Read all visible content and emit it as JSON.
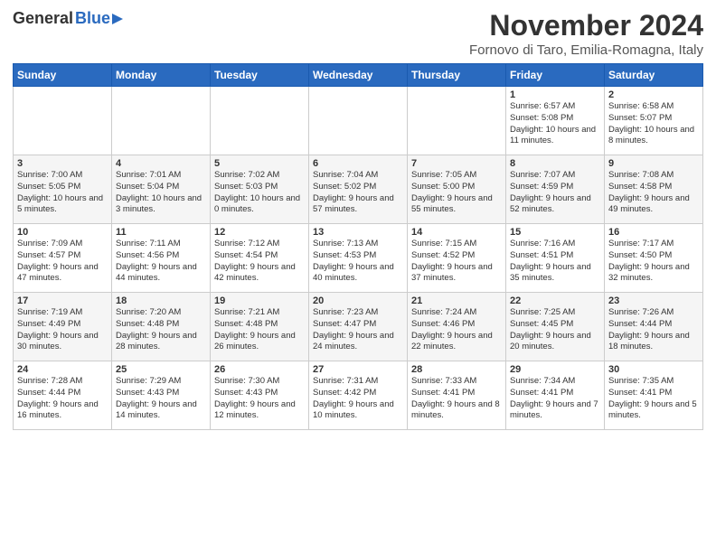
{
  "header": {
    "logo_general": "General",
    "logo_blue": "Blue",
    "title": "November 2024",
    "location": "Fornovo di Taro, Emilia-Romagna, Italy"
  },
  "days_of_week": [
    "Sunday",
    "Monday",
    "Tuesday",
    "Wednesday",
    "Thursday",
    "Friday",
    "Saturday"
  ],
  "weeks": [
    [
      {
        "day": "",
        "info": ""
      },
      {
        "day": "",
        "info": ""
      },
      {
        "day": "",
        "info": ""
      },
      {
        "day": "",
        "info": ""
      },
      {
        "day": "",
        "info": ""
      },
      {
        "day": "1",
        "info": "Sunrise: 6:57 AM\nSunset: 5:08 PM\nDaylight: 10 hours and 11 minutes."
      },
      {
        "day": "2",
        "info": "Sunrise: 6:58 AM\nSunset: 5:07 PM\nDaylight: 10 hours and 8 minutes."
      }
    ],
    [
      {
        "day": "3",
        "info": "Sunrise: 7:00 AM\nSunset: 5:05 PM\nDaylight: 10 hours and 5 minutes."
      },
      {
        "day": "4",
        "info": "Sunrise: 7:01 AM\nSunset: 5:04 PM\nDaylight: 10 hours and 3 minutes."
      },
      {
        "day": "5",
        "info": "Sunrise: 7:02 AM\nSunset: 5:03 PM\nDaylight: 10 hours and 0 minutes."
      },
      {
        "day": "6",
        "info": "Sunrise: 7:04 AM\nSunset: 5:02 PM\nDaylight: 9 hours and 57 minutes."
      },
      {
        "day": "7",
        "info": "Sunrise: 7:05 AM\nSunset: 5:00 PM\nDaylight: 9 hours and 55 minutes."
      },
      {
        "day": "8",
        "info": "Sunrise: 7:07 AM\nSunset: 4:59 PM\nDaylight: 9 hours and 52 minutes."
      },
      {
        "day": "9",
        "info": "Sunrise: 7:08 AM\nSunset: 4:58 PM\nDaylight: 9 hours and 49 minutes."
      }
    ],
    [
      {
        "day": "10",
        "info": "Sunrise: 7:09 AM\nSunset: 4:57 PM\nDaylight: 9 hours and 47 minutes."
      },
      {
        "day": "11",
        "info": "Sunrise: 7:11 AM\nSunset: 4:56 PM\nDaylight: 9 hours and 44 minutes."
      },
      {
        "day": "12",
        "info": "Sunrise: 7:12 AM\nSunset: 4:54 PM\nDaylight: 9 hours and 42 minutes."
      },
      {
        "day": "13",
        "info": "Sunrise: 7:13 AM\nSunset: 4:53 PM\nDaylight: 9 hours and 40 minutes."
      },
      {
        "day": "14",
        "info": "Sunrise: 7:15 AM\nSunset: 4:52 PM\nDaylight: 9 hours and 37 minutes."
      },
      {
        "day": "15",
        "info": "Sunrise: 7:16 AM\nSunset: 4:51 PM\nDaylight: 9 hours and 35 minutes."
      },
      {
        "day": "16",
        "info": "Sunrise: 7:17 AM\nSunset: 4:50 PM\nDaylight: 9 hours and 32 minutes."
      }
    ],
    [
      {
        "day": "17",
        "info": "Sunrise: 7:19 AM\nSunset: 4:49 PM\nDaylight: 9 hours and 30 minutes."
      },
      {
        "day": "18",
        "info": "Sunrise: 7:20 AM\nSunset: 4:48 PM\nDaylight: 9 hours and 28 minutes."
      },
      {
        "day": "19",
        "info": "Sunrise: 7:21 AM\nSunset: 4:48 PM\nDaylight: 9 hours and 26 minutes."
      },
      {
        "day": "20",
        "info": "Sunrise: 7:23 AM\nSunset: 4:47 PM\nDaylight: 9 hours and 24 minutes."
      },
      {
        "day": "21",
        "info": "Sunrise: 7:24 AM\nSunset: 4:46 PM\nDaylight: 9 hours and 22 minutes."
      },
      {
        "day": "22",
        "info": "Sunrise: 7:25 AM\nSunset: 4:45 PM\nDaylight: 9 hours and 20 minutes."
      },
      {
        "day": "23",
        "info": "Sunrise: 7:26 AM\nSunset: 4:44 PM\nDaylight: 9 hours and 18 minutes."
      }
    ],
    [
      {
        "day": "24",
        "info": "Sunrise: 7:28 AM\nSunset: 4:44 PM\nDaylight: 9 hours and 16 minutes."
      },
      {
        "day": "25",
        "info": "Sunrise: 7:29 AM\nSunset: 4:43 PM\nDaylight: 9 hours and 14 minutes."
      },
      {
        "day": "26",
        "info": "Sunrise: 7:30 AM\nSunset: 4:43 PM\nDaylight: 9 hours and 12 minutes."
      },
      {
        "day": "27",
        "info": "Sunrise: 7:31 AM\nSunset: 4:42 PM\nDaylight: 9 hours and 10 minutes."
      },
      {
        "day": "28",
        "info": "Sunrise: 7:33 AM\nSunset: 4:41 PM\nDaylight: 9 hours and 8 minutes."
      },
      {
        "day": "29",
        "info": "Sunrise: 7:34 AM\nSunset: 4:41 PM\nDaylight: 9 hours and 7 minutes."
      },
      {
        "day": "30",
        "info": "Sunrise: 7:35 AM\nSunset: 4:41 PM\nDaylight: 9 hours and 5 minutes."
      }
    ]
  ]
}
